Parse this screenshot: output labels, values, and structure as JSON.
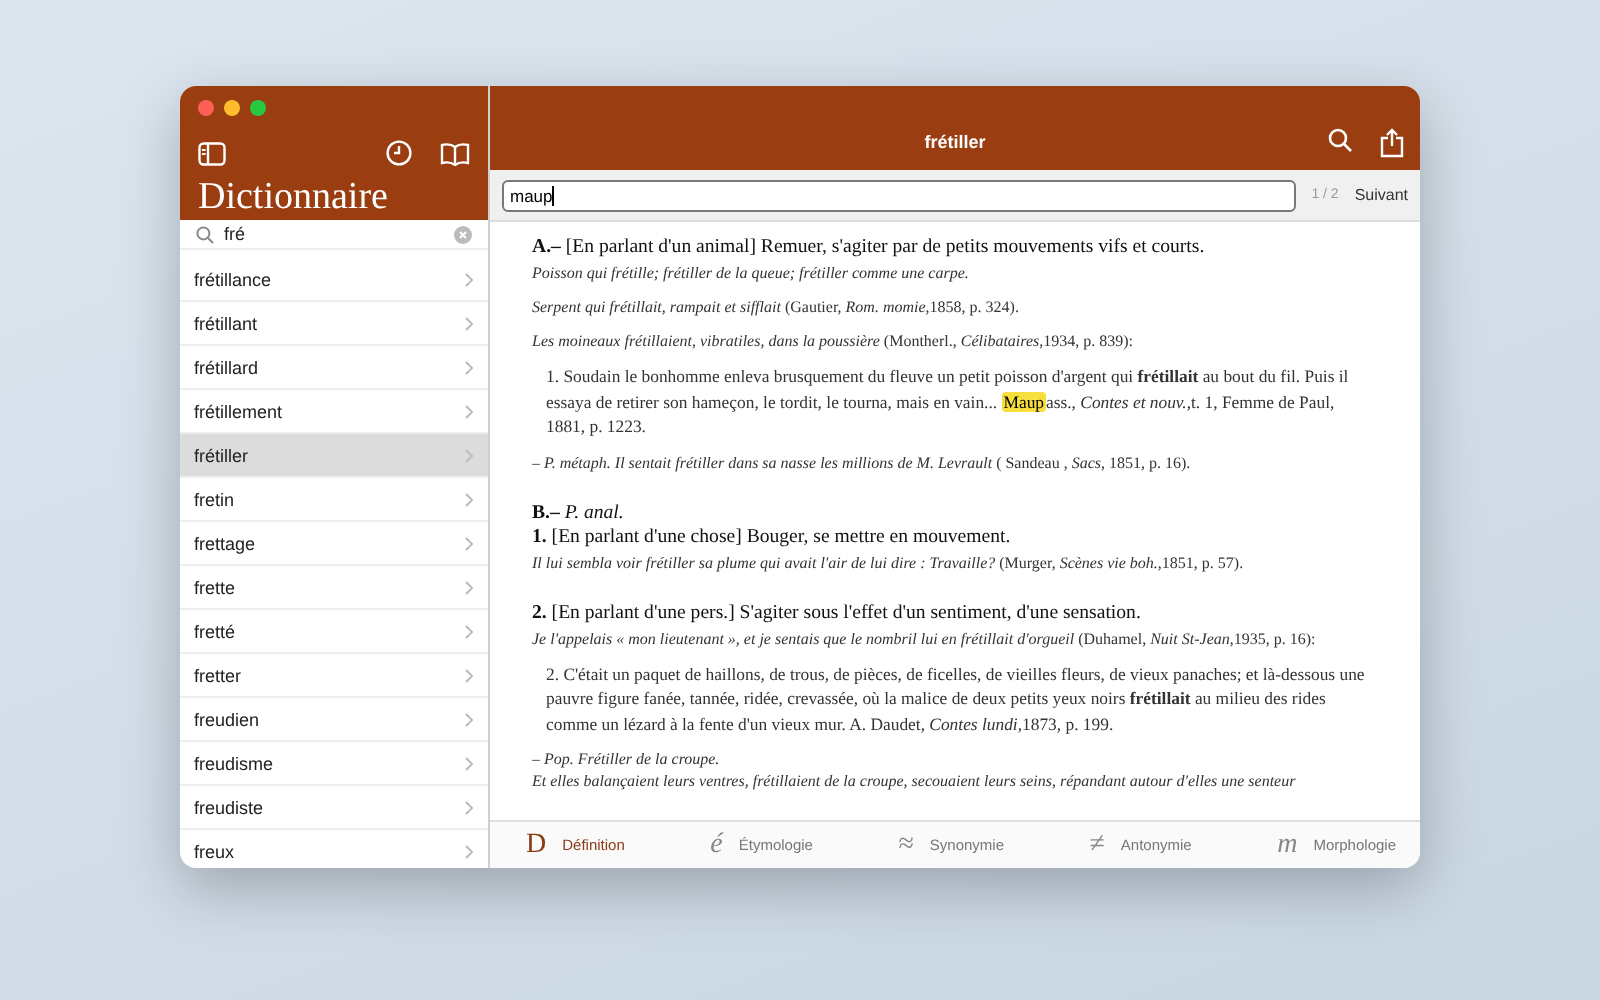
{
  "window": {
    "title": "frétiller"
  },
  "sidebar": {
    "title": "Dictionnaire",
    "search": {
      "value": "fré"
    },
    "items": [
      {
        "label": "frétillance",
        "selected": false
      },
      {
        "label": "frétillant",
        "selected": false
      },
      {
        "label": "frétillard",
        "selected": false
      },
      {
        "label": "frétillement",
        "selected": false
      },
      {
        "label": "frétiller",
        "selected": true
      },
      {
        "label": "fretin",
        "selected": false
      },
      {
        "label": "frettage",
        "selected": false
      },
      {
        "label": "frette",
        "selected": false
      },
      {
        "label": "fretté",
        "selected": false
      },
      {
        "label": "fretter",
        "selected": false
      },
      {
        "label": "freudien",
        "selected": false
      },
      {
        "label": "freudisme",
        "selected": false
      },
      {
        "label": "freudiste",
        "selected": false
      },
      {
        "label": "freux",
        "selected": false
      }
    ]
  },
  "find_bar": {
    "value": "maup",
    "count": "1 / 2",
    "next": "Suivant"
  },
  "sections": [
    {
      "paragraphs": [
        {
          "kind": "heading",
          "lines": [
            "**A.–** [En parlant d'un animal] Remuer, s'agiter par de petits mouvements vifs et courts."
          ]
        },
        {
          "kind": "example",
          "lines": [
            "*Poisson qui frétille; frétiller de la queue; frétiller comme une carpe.*"
          ]
        },
        {
          "kind": "example",
          "lines": [
            "*Serpent qui frétillait, rampait et sifflait* (Gautier, *Rom. momie*,1858, p. 324)."
          ]
        },
        {
          "kind": "example",
          "lines": [
            "*Les moineaux frétillaient, vibratiles, dans la poussière* (Montherl., *Célibataires*,1934, p. 839):"
          ]
        },
        {
          "kind": "quote",
          "lines": [
            "1. Soudain le bonhomme enleva brusquement du fleuve un petit poisson d'argent qui **frétillait** au bout du fil. Puis il essaya de retirer son hameçon, le tordit, le tourna, mais en vain..."
          ],
          "match": "Maup",
          "after": "ass., *Contes et nouv.*,t. 1, Femme de Paul, 1881, p. 1223."
        },
        {
          "kind": "example",
          "lines": [
            "–  *P. métaph.  Il sentait frétiller dans sa nasse les millions de M. Levrault* (  Sandeau , *Sacs*, 1851, p. 16)."
          ]
        }
      ]
    },
    {
      "paragraphs": [
        {
          "kind": "heading",
          "lines": [
            "**B.–** *P. anal.*",
            "**1.** [En parlant d'une chose] Bouger, se mettre en mouvement."
          ]
        },
        {
          "kind": "example",
          "lines": [
            "*Il lui sembla voir frétiller sa plume qui avait l'air de lui dire : Travaille?* (Murger, *Scènes vie boh.*,1851, p. 57)."
          ]
        }
      ]
    },
    {
      "paragraphs": [
        {
          "kind": "heading",
          "lines": [
            "**2.** [En parlant d'une pers.] S'agiter sous l'effet d'un sentiment, d'une sensation."
          ]
        },
        {
          "kind": "example",
          "lines": [
            "*Je l'appelais « mon lieutenant », et je sentais que le nombril lui en frétillait d'orgueil* (Duhamel, *Nuit St-Jean*,1935, p. 16):"
          ]
        },
        {
          "kind": "quote",
          "lines": [
            "2. C'était un paquet de haillons, de trous, de pièces, de ficelles, de vieilles fleurs, de vieux panaches; et là-dessous une pauvre figure fanée, tannée, ridée, crevassée, où la malice de deux petits yeux noirs **frétillait** au milieu des rides comme un lézard à la fente d'un vieux mur. A. Daudet, *Contes lundi*,1873, p. 199."
          ]
        },
        {
          "kind": "example",
          "lines": [
            "–  *Pop.  Frétiller de la croupe.*",
            " *Et elles balançaient leurs ventres, frétillaient de la croupe, secouaient leurs seins, répandant autour d'elles une senteur*"
          ]
        }
      ]
    }
  ],
  "tabs": [
    {
      "glyph": "D",
      "label": "Définition",
      "selected": true
    },
    {
      "glyph": "é",
      "label": "Étymologie",
      "selected": false
    },
    {
      "glyph": "≈",
      "label": "Synonymie",
      "selected": false
    },
    {
      "glyph": "≠",
      "label": "Antonymie",
      "selected": false
    },
    {
      "glyph": "m",
      "label": "Morphologie",
      "selected": false
    }
  ]
}
